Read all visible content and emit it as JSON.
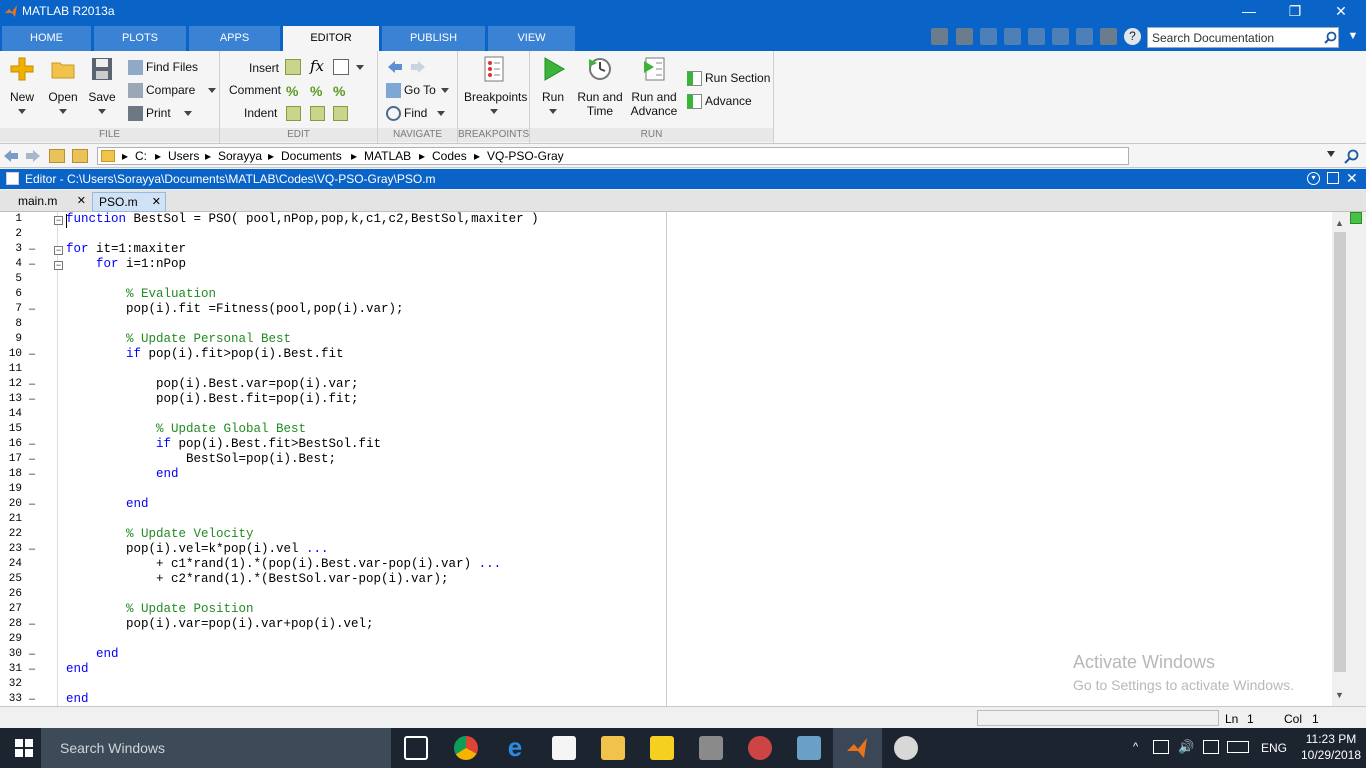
{
  "window": {
    "title": "MATLAB R2013a"
  },
  "tabs": [
    "HOME",
    "PLOTS",
    "APPS",
    "EDITOR",
    "PUBLISH",
    "VIEW"
  ],
  "search": {
    "placeholder": "Search Documentation"
  },
  "toolstrip": {
    "file": {
      "header": "FILE",
      "new": "New",
      "open": "Open",
      "save": "Save",
      "find_files": "Find Files",
      "compare": "Compare",
      "print": "Print"
    },
    "edit": {
      "header": "EDIT",
      "insert": "Insert",
      "comment": "Comment",
      "indent": "Indent"
    },
    "navigate": {
      "header": "NAVIGATE",
      "go_to": "Go To",
      "find": "Find"
    },
    "breakpoints": {
      "header": "BREAKPOINTS",
      "breakpoints": "Breakpoints"
    },
    "run": {
      "header": "RUN",
      "run": "Run",
      "run_time": [
        "Run and",
        "Time"
      ],
      "run_advance": [
        "Run and",
        "Advance"
      ],
      "run_section": "Run Section",
      "advance": "Advance"
    }
  },
  "address": {
    "crumbs": [
      "C:",
      "Users",
      "Sorayya",
      "Documents",
      "MATLAB",
      "Codes",
      "VQ-PSO-Gray"
    ]
  },
  "editor": {
    "title": "Editor - C:\\Users\\Sorayya\\Documents\\MATLAB\\Codes\\VQ-PSO-Gray\\PSO.m",
    "doc_tabs": [
      "main.m",
      "PSO.m"
    ],
    "active_tab": "PSO.m"
  },
  "code_lines": [
    {
      "n": "1",
      "dash": false,
      "fold": "−",
      "parts": [
        [
          "kw",
          "function"
        ],
        [
          "t",
          " BestSol = PSO( pool,nPop,pop,k,c1,c2,BestSol,maxiter )"
        ]
      ]
    },
    {
      "n": "2",
      "dash": false,
      "parts": []
    },
    {
      "n": "3",
      "dash": true,
      "fold": "−",
      "parts": [
        [
          "kw",
          "for"
        ],
        [
          "t",
          " it=1:maxiter"
        ]
      ]
    },
    {
      "n": "4",
      "dash": true,
      "fold": "−",
      "parts": [
        [
          "t",
          "    "
        ],
        [
          "kw",
          "for"
        ],
        [
          "t",
          " i=1:nPop"
        ]
      ]
    },
    {
      "n": "5",
      "dash": false,
      "parts": []
    },
    {
      "n": "6",
      "dash": false,
      "parts": [
        [
          "t",
          "        "
        ],
        [
          "cm",
          "% Evaluation"
        ]
      ]
    },
    {
      "n": "7",
      "dash": true,
      "parts": [
        [
          "t",
          "        pop(i).fit =Fitness(pool,pop(i).var);"
        ]
      ]
    },
    {
      "n": "8",
      "dash": false,
      "parts": []
    },
    {
      "n": "9",
      "dash": false,
      "parts": [
        [
          "t",
          "        "
        ],
        [
          "cm",
          "% Update Personal Best"
        ]
      ]
    },
    {
      "n": "10",
      "dash": true,
      "parts": [
        [
          "t",
          "        "
        ],
        [
          "kw",
          "if"
        ],
        [
          "t",
          " pop(i).fit>pop(i).Best.fit"
        ]
      ]
    },
    {
      "n": "11",
      "dash": false,
      "parts": []
    },
    {
      "n": "12",
      "dash": true,
      "parts": [
        [
          "t",
          "            pop(i).Best.var=pop(i).var;"
        ]
      ]
    },
    {
      "n": "13",
      "dash": true,
      "parts": [
        [
          "t",
          "            pop(i).Best.fit=pop(i).fit;"
        ]
      ]
    },
    {
      "n": "14",
      "dash": false,
      "parts": []
    },
    {
      "n": "15",
      "dash": false,
      "parts": [
        [
          "t",
          "            "
        ],
        [
          "cm",
          "% Update Global Best"
        ]
      ]
    },
    {
      "n": "16",
      "dash": true,
      "parts": [
        [
          "t",
          "            "
        ],
        [
          "kw",
          "if"
        ],
        [
          "t",
          " pop(i).Best.fit>BestSol.fit"
        ]
      ]
    },
    {
      "n": "17",
      "dash": true,
      "parts": [
        [
          "t",
          "                BestSol=pop(i).Best;"
        ]
      ]
    },
    {
      "n": "18",
      "dash": true,
      "parts": [
        [
          "t",
          "            "
        ],
        [
          "kw",
          "end"
        ]
      ]
    },
    {
      "n": "19",
      "dash": false,
      "parts": []
    },
    {
      "n": "20",
      "dash": true,
      "parts": [
        [
          "t",
          "        "
        ],
        [
          "kw",
          "end"
        ]
      ]
    },
    {
      "n": "21",
      "dash": false,
      "parts": []
    },
    {
      "n": "22",
      "dash": false,
      "parts": [
        [
          "t",
          "        "
        ],
        [
          "cm",
          "% Update Velocity"
        ]
      ]
    },
    {
      "n": "23",
      "dash": true,
      "parts": [
        [
          "t",
          "        pop(i).vel=k*pop(i).vel "
        ],
        [
          "kw",
          "..."
        ]
      ]
    },
    {
      "n": "24",
      "dash": false,
      "parts": [
        [
          "t",
          "            + c1*rand(1).*(pop(i).Best.var-pop(i).var) "
        ],
        [
          "kw",
          "..."
        ]
      ]
    },
    {
      "n": "25",
      "dash": false,
      "parts": [
        [
          "t",
          "            + c2*rand(1).*(BestSol.var-pop(i).var);"
        ]
      ]
    },
    {
      "n": "26",
      "dash": false,
      "parts": []
    },
    {
      "n": "27",
      "dash": false,
      "parts": [
        [
          "t",
          "        "
        ],
        [
          "cm",
          "% Update Position"
        ]
      ]
    },
    {
      "n": "28",
      "dash": true,
      "parts": [
        [
          "t",
          "        pop(i).var=pop(i).var+pop(i).vel;"
        ]
      ]
    },
    {
      "n": "29",
      "dash": false,
      "parts": []
    },
    {
      "n": "30",
      "dash": true,
      "parts": [
        [
          "t",
          "    "
        ],
        [
          "kw",
          "end"
        ]
      ]
    },
    {
      "n": "31",
      "dash": true,
      "parts": [
        [
          "kw",
          "end"
        ]
      ]
    },
    {
      "n": "32",
      "dash": false,
      "parts": []
    },
    {
      "n": "33",
      "dash": true,
      "parts": [
        [
          "kw",
          "end"
        ]
      ]
    }
  ],
  "watermark": {
    "line1": "Activate Windows",
    "line2": "Go to Settings to activate Windows."
  },
  "status": {
    "ln_label": "Ln",
    "ln": "1",
    "col_label": "Col",
    "col": "1"
  },
  "taskbar": {
    "search": "Search Windows",
    "lang": "ENG",
    "time": "11:23 PM",
    "date": "10/29/2018"
  },
  "colors": {
    "accent": "#0a64c8",
    "keyword": "#0000ff",
    "comment": "#228b22"
  }
}
